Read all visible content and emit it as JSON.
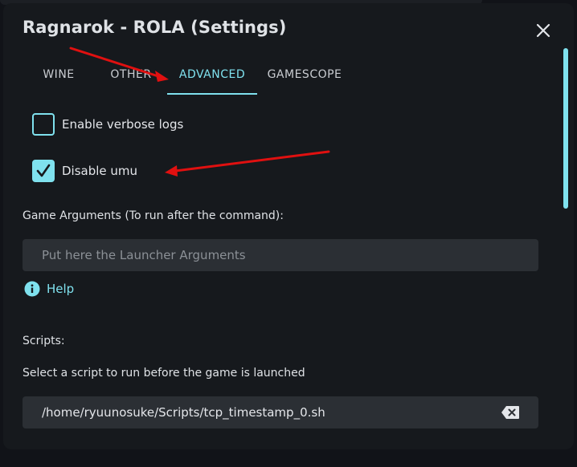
{
  "dialog": {
    "title": "Ragnarok - ROLA (Settings)"
  },
  "tabs": [
    {
      "label": "WINE",
      "active": false
    },
    {
      "label": "OTHER",
      "active": false
    },
    {
      "label": "ADVANCED",
      "active": true
    },
    {
      "label": "GAMESCOPE",
      "active": false
    }
  ],
  "options": {
    "verbose_logs": {
      "label": "Enable verbose logs",
      "checked": false
    },
    "disable_umu": {
      "label": "Disable umu",
      "checked": true
    }
  },
  "game_arguments": {
    "label": "Game Arguments (To run after the command):",
    "value": "",
    "placeholder": "Put here the Launcher Arguments"
  },
  "help": {
    "label": "Help",
    "icon": "info-icon"
  },
  "scripts": {
    "label": "Scripts:",
    "description": "Select a script to run before the game is launched",
    "path": "/home/ryuunosuke/Scripts/tcp_timestamp_0.sh",
    "clear_icon": "backspace-clear-icon"
  },
  "colors": {
    "accent": "#7fe1ee",
    "background": "#16191d",
    "input_background": "#2b2f34",
    "annotation_arrow": "#e01010"
  }
}
